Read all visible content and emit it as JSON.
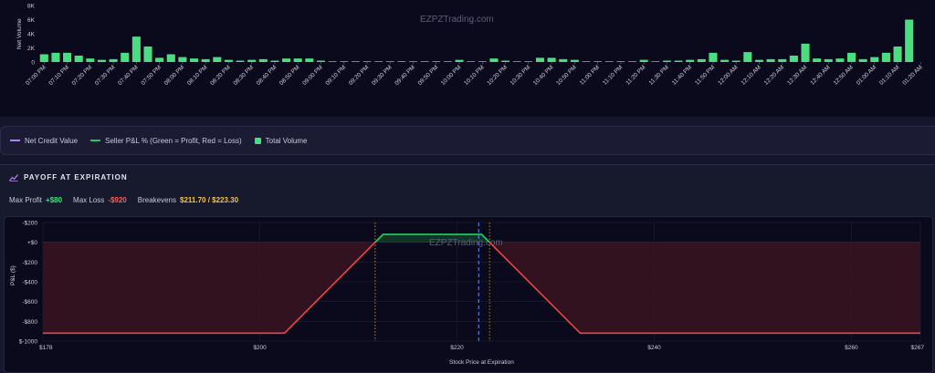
{
  "watermark": "EZPZTrading.com",
  "volume_chart": {
    "chart_data": {
      "type": "bar",
      "ylabel": "Net Volume",
      "ylim": [
        0,
        8000
      ],
      "yticks": [
        "8K",
        "6K",
        "4K",
        "2K",
        "0"
      ],
      "yticks_values": [
        8000,
        6000,
        4000,
        2000,
        0
      ],
      "categories": [
        "07:00 PM",
        "07:05 PM",
        "07:10 PM",
        "07:15 PM",
        "07:20 PM",
        "07:25 PM",
        "07:30 PM",
        "07:35 PM",
        "07:40 PM",
        "07:45 PM",
        "07:50 PM",
        "07:55 PM",
        "08:00 PM",
        "08:05 PM",
        "08:10 PM",
        "08:15 PM",
        "08:20 PM",
        "08:25 PM",
        "08:30 PM",
        "08:35 PM",
        "08:40 PM",
        "08:45 PM",
        "08:50 PM",
        "08:55 PM",
        "09:00 PM",
        "09:05 PM",
        "09:10 PM",
        "09:15 PM",
        "09:20 PM",
        "09:25 PM",
        "09:30 PM",
        "09:35 PM",
        "09:40 PM",
        "09:45 PM",
        "09:50 PM",
        "09:55 PM",
        "10:00 PM",
        "10:05 PM",
        "10:10 PM",
        "10:15 PM",
        "10:20 PM",
        "10:25 PM",
        "10:30 PM",
        "10:35 PM",
        "10:40 PM",
        "10:45 PM",
        "10:50 PM",
        "10:55 PM",
        "11:00 PM",
        "11:05 PM",
        "11:10 PM",
        "11:15 PM",
        "11:20 PM",
        "11:25 PM",
        "11:30 PM",
        "11:35 PM",
        "11:40 PM",
        "11:45 PM",
        "11:50 PM",
        "11:55 PM",
        "12:00 AM",
        "12:05 AM",
        "12:10 AM",
        "12:15 AM",
        "12:20 AM",
        "12:25 AM",
        "12:30 AM",
        "12:35 AM",
        "12:40 AM",
        "12:45 AM",
        "12:50 AM",
        "12:55 AM",
        "01:00 AM",
        "01:05 AM",
        "01:10 AM",
        "01:15 AM",
        "01:20 AM",
        "01:25 AM"
      ],
      "tick_labels": [
        "07:00 PM",
        "07:10 PM",
        "07:20 PM",
        "07:30 PM",
        "07:40 PM",
        "07:50 PM",
        "08:00 PM",
        "08:10 PM",
        "08:20 PM",
        "08:30 PM",
        "08:40 PM",
        "08:50 PM",
        "09:00 PM",
        "09:10 PM",
        "09:20 PM",
        "09:30 PM",
        "09:40 PM",
        "09:50 PM",
        "10:00 PM",
        "10:10 PM",
        "10:20 PM",
        "10:30 PM",
        "10:40 PM",
        "10:50 PM",
        "11:00 PM",
        "11:10 PM",
        "11:20 PM",
        "11:30 PM",
        "11:40 PM",
        "11:50 PM",
        "12:00 AM",
        "12:10 AM",
        "12:20 AM",
        "12:30 AM",
        "12:40 AM",
        "12:50 AM",
        "01:00 AM",
        "01:10 AM",
        "01:20 AM"
      ],
      "values": [
        1100,
        1300,
        1300,
        900,
        500,
        300,
        400,
        1300,
        3600,
        2200,
        600,
        1100,
        700,
        500,
        400,
        700,
        300,
        200,
        300,
        400,
        200,
        500,
        500,
        500,
        200,
        100,
        100,
        100,
        100,
        100,
        100,
        100,
        100,
        100,
        100,
        100,
        300,
        100,
        100,
        500,
        200,
        100,
        100,
        600,
        600,
        400,
        300,
        100,
        100,
        100,
        100,
        100,
        300,
        100,
        200,
        200,
        300,
        400,
        1300,
        300,
        200,
        1400,
        300,
        400,
        400,
        900,
        2600,
        500,
        400,
        500,
        1300,
        400,
        700,
        1300,
        2200,
        6000
      ],
      "bar_color": "#4ade80"
    }
  },
  "legend": {
    "items": [
      {
        "label": "Net Credit Value",
        "color": "#b084f5"
      },
      {
        "label": "Seller P&L % (Green = Profit, Red = Loss)",
        "color": "#22c55e"
      },
      {
        "label": "Total Volume",
        "color": "#4ade80"
      }
    ]
  },
  "payoff": {
    "title": "PAYOFF AT EXPIRATION",
    "max_profit_label": "Max Profit",
    "max_profit_value": "+$80",
    "max_loss_label": "Max Loss",
    "max_loss_value": "-$920",
    "breakevens_label": "Breakevens",
    "breakevens_value": "$211.70 / $223.30",
    "chart_data": {
      "type": "line",
      "xlabel": "Stock Price at Expiration",
      "ylabel": "P&L ($)",
      "xlim": [
        178,
        267
      ],
      "ylim": [
        -1000,
        200
      ],
      "xticks": [
        178,
        200,
        220,
        240,
        260,
        267
      ],
      "xtick_labels": [
        "$178",
        "$200",
        "$220",
        "$240",
        "$260",
        "$267"
      ],
      "yticks": [
        200,
        0,
        -200,
        -400,
        -600,
        -800,
        -1000
      ],
      "ytick_labels": [
        "-$200",
        "+$0",
        "-$200",
        "-$400",
        "-$600",
        "-$800",
        "$-1000"
      ],
      "series": [
        {
          "x": [
            178,
            202.5,
            211.7,
            212.5,
            222.5,
            223.3,
            232.5,
            267
          ],
          "y": [
            -920,
            -920,
            0,
            80,
            80,
            0,
            -920,
            -920
          ]
        }
      ],
      "breakevens": [
        211.7,
        223.3
      ],
      "current_price": 222.2,
      "profit_color": "#22c55e",
      "loss_color": "#ef4444"
    }
  }
}
